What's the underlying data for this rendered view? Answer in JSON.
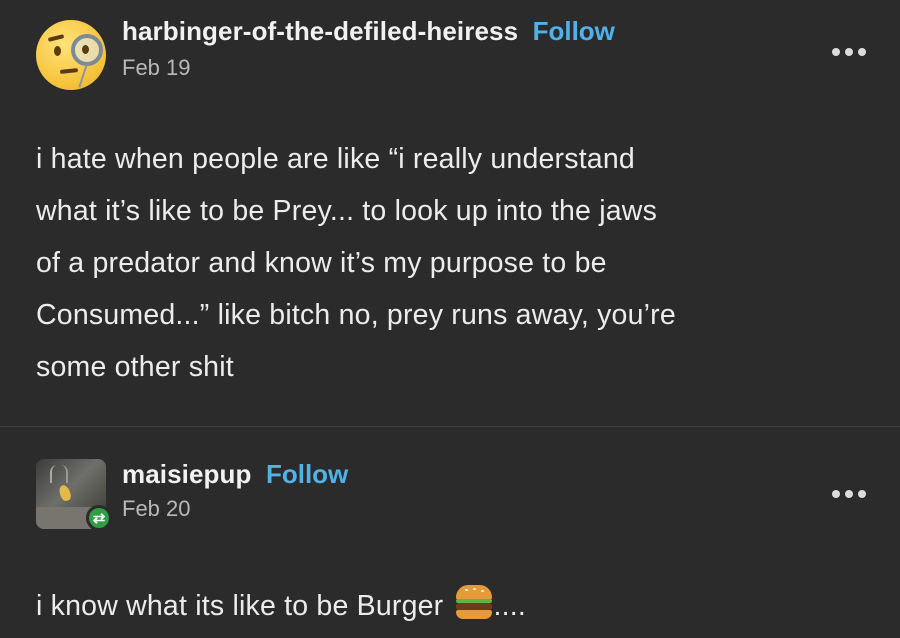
{
  "posts": [
    {
      "username": "harbinger-of-the-defiled-heiress",
      "follow_label": "Follow",
      "date": "Feb 19",
      "avatar_icon": "monocle-face-emoji-icon",
      "body": "i hate when people are like “i really understand\nwhat it’s like to be Prey... to look up into the jaws\nof a predator and know it’s my purpose to be\nConsumed...” like bitch no, prey runs away, you’re\nsome other shit"
    },
    {
      "username": "maisiepup",
      "follow_label": "Follow",
      "date": "Feb 20",
      "avatar_icon": "photo-avatar",
      "badge_icon": "reblog-icon",
      "body_before_emoji": "i know what its like to be Burger ",
      "body_emoji": "hamburger-emoji-icon",
      "body_after_emoji": "...."
    }
  ],
  "colors": {
    "background": "#2b2b2c",
    "follow_link": "#4fb2e8",
    "text": "#ececec",
    "date": "#b9b9b9",
    "reblog_badge": "#2f9e44"
  }
}
